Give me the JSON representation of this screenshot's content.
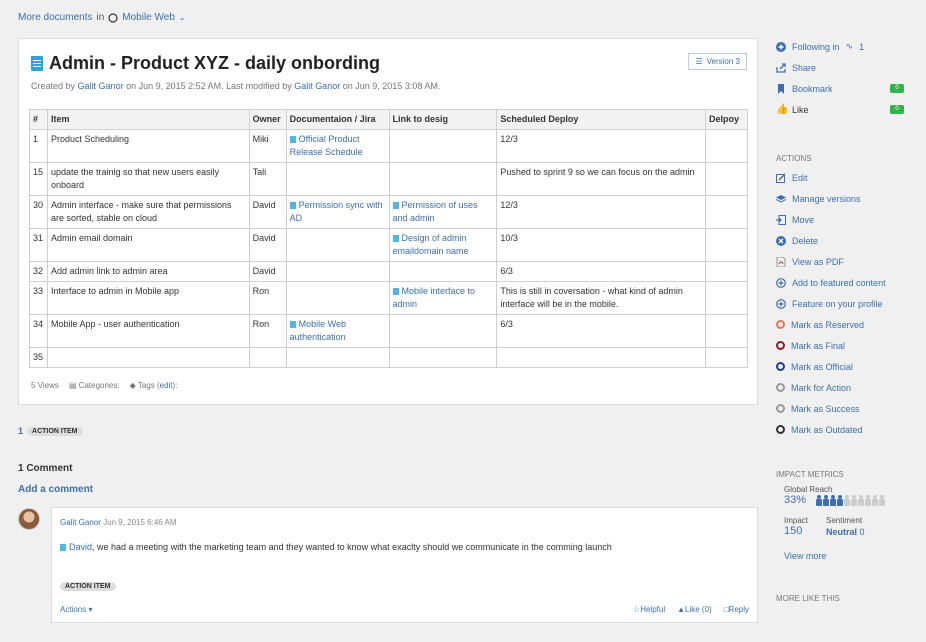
{
  "breadcrumb": {
    "more_docs": "More documents",
    "in": "in",
    "space": "Mobile Web"
  },
  "doc": {
    "title": "Admin - Product XYZ - daily onbording",
    "version": "Version 3",
    "byline": {
      "created_by": "Created by",
      "creator": "Galit Ganor",
      "created_on": "on Jun 9, 2015 2:52 AM. Last modified by",
      "modifier": "Galit Ganor",
      "modified_on": "on Jun 9, 2015 3:08 AM."
    },
    "table": {
      "headers": [
        "#",
        "Item",
        "Owner",
        "Documentaion / Jira",
        "Link to desig",
        "Scheduled Deploy",
        "Delpoy"
      ],
      "rows": [
        [
          "1",
          "Product Scheduling",
          "Miki",
          "Official Product Release Schedule",
          "",
          "12/3",
          ""
        ],
        [
          "15",
          "update the trainig so that new users easily onboard",
          "Tali",
          "",
          "",
          "Pushed to sprint 9 so we can focus on the admin",
          ""
        ],
        [
          "30",
          "Admin interface - make sure that permissions are sorted, stable on cloud",
          "David",
          "Permission sync with AD",
          "Permission of uses and admin",
          "12/3",
          ""
        ],
        [
          "31",
          "Admin email domain",
          "David",
          "",
          "Design of admin emaildomain name",
          "10/3",
          ""
        ],
        [
          "32",
          "Add admin link to admin area",
          "David",
          "",
          "",
          "6/3",
          ""
        ],
        [
          "33",
          "Interface to admin in Mobile app",
          "Ron",
          "",
          "Mobile interface to admin",
          "This is still in coversation - what kind of admin interface will be in the mobile.",
          ""
        ],
        [
          "34",
          "Mobile App - user authentication",
          "Ron",
          "Mobile Web authentication",
          "",
          "6/3",
          ""
        ],
        [
          "35",
          "",
          "",
          "",
          "",
          "",
          ""
        ]
      ]
    },
    "meta": {
      "views": "5 Views",
      "categories": "Categories:",
      "tags": "Tags (",
      "edit": "edit",
      "tags_end": "):"
    }
  },
  "action_items": {
    "count": "1",
    "label": "ACTION ITEM"
  },
  "comments": {
    "title": "1 Comment",
    "add": "Add a comment",
    "item": {
      "author": "Galit Ganor",
      "date": "Jun 9, 2015 6:46 AM",
      "mention": "David",
      "text": ", we had a meeting with the marketing team and they wanted to know what exaclty should we communicate in the comming launch",
      "badge": "ACTION ITEM",
      "actions": "Actions",
      "helpful": "Helpful",
      "like": "Like (0)",
      "reply": "Reply"
    }
  },
  "sidebar": {
    "following": "Following in",
    "following_count": "1",
    "share": "Share",
    "bookmark": "Bookmark",
    "bookmark_count": "0",
    "like": "Like",
    "like_count": "0",
    "actions_head": "ACTIONS",
    "actions": [
      {
        "label": "Edit",
        "icon": "edit-icon"
      },
      {
        "label": "Manage versions",
        "icon": "layers-icon"
      },
      {
        "label": "Move",
        "icon": "move-icon"
      },
      {
        "label": "Delete",
        "icon": "delete-icon"
      },
      {
        "label": "View as PDF",
        "icon": "pdf-icon"
      },
      {
        "label": "Add to featured content",
        "icon": "plus-circle-icon"
      },
      {
        "label": "Feature on your profile",
        "icon": "plus-circle-icon"
      }
    ],
    "marks": [
      {
        "label": "Mark as Reserved",
        "color": "#e8735a"
      },
      {
        "label": "Mark as Final",
        "color": "#8b1a2b"
      },
      {
        "label": "Mark as Official",
        "color": "#1f3f8f"
      },
      {
        "label": "Mark for Action",
        "color": "#999999"
      },
      {
        "label": "Mark as Success",
        "color": "#999999"
      },
      {
        "label": "Mark as Outdated",
        "color": "#333333"
      }
    ],
    "impact_head": "IMPACT METRICS",
    "global_reach_label": "Global Reach",
    "global_reach": "33%",
    "impact_label": "Impact",
    "impact": "150",
    "sentiment_label": "Sentiment",
    "sentiment": "Neutral",
    "sentiment_value": "0",
    "view_more": "View more",
    "more_like_this": "MORE LIKE THIS"
  }
}
